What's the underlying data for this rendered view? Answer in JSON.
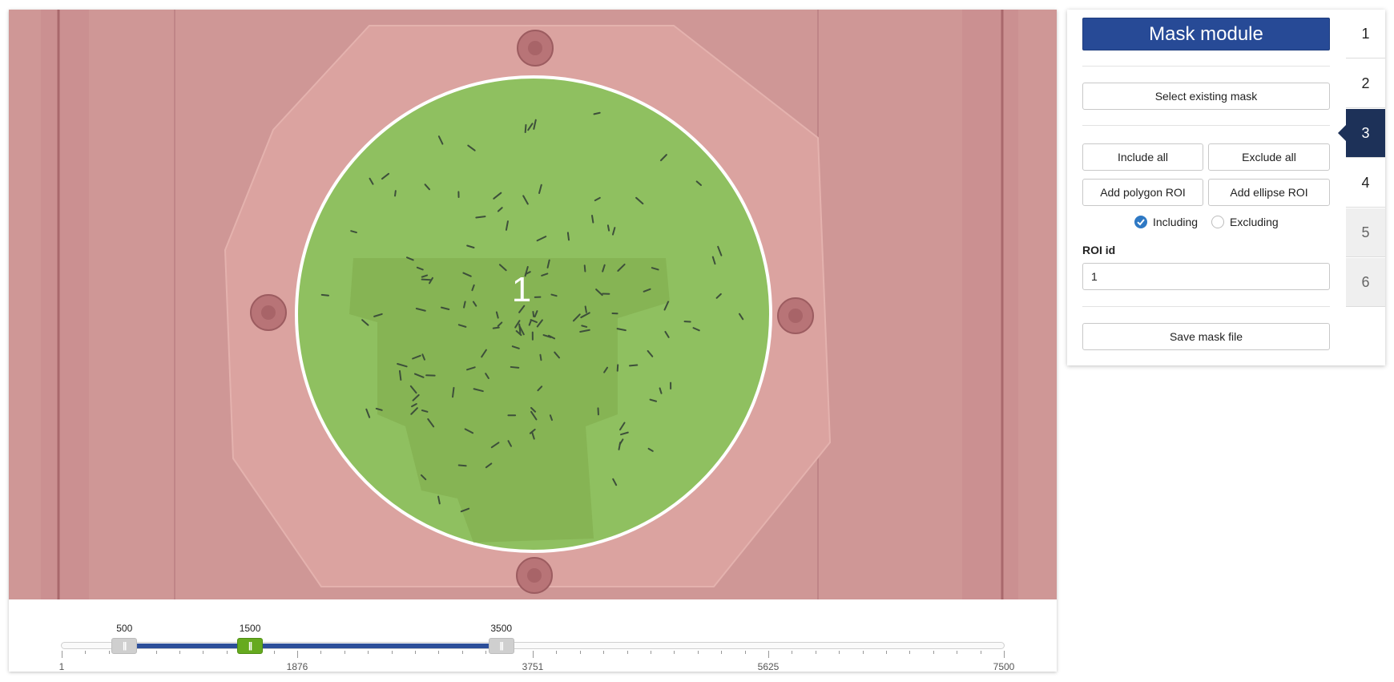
{
  "viewer": {
    "roi_label": "1",
    "colors": {
      "excluded": "#cf9796",
      "included": "#8fc060",
      "outline": "#ffffff"
    }
  },
  "slider": {
    "min": 1,
    "max": 7500,
    "handles": [
      {
        "value": 500,
        "label": "500",
        "color": "grey"
      },
      {
        "value": 1500,
        "label": "1500",
        "color": "green"
      },
      {
        "value": 3500,
        "label": "3500",
        "color": "grey"
      }
    ],
    "ticks": [
      "1",
      "1876",
      "3751",
      "5625",
      "7500"
    ],
    "colors": {
      "range": "#2d4f9a",
      "current": "#66aa1f"
    }
  },
  "panel": {
    "title": "Mask module",
    "select_existing_label": "Select existing mask",
    "include_all_label": "Include all",
    "exclude_all_label": "Exclude all",
    "add_polygon_label": "Add polygon ROI",
    "add_ellipse_label": "Add ellipse ROI",
    "mode": {
      "including_label": "Including",
      "excluding_label": "Excluding",
      "selected": "Including"
    },
    "roi_id_label": "ROI id",
    "roi_id_value": "1",
    "save_label": "Save mask file",
    "accent": "#274a96"
  },
  "steps": {
    "items": [
      "1",
      "2",
      "3",
      "4",
      "5",
      "6"
    ],
    "active": "3",
    "disabled": [
      "5",
      "6"
    ]
  }
}
